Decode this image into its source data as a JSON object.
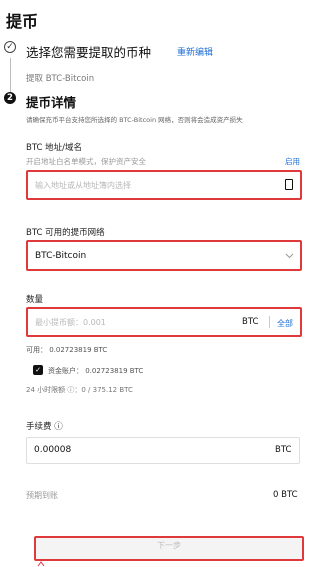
{
  "page": {
    "title": "提币"
  },
  "step1": {
    "number": "✓",
    "title": "选择您需要提取的币种",
    "edit_label": "重新编辑",
    "selected": "提取 BTC-Bitcoin"
  },
  "step2": {
    "number": "2",
    "title": "提币详情",
    "notice": "请确保充币平台支持您所选择的 BTC-Bitcoin 网络，否则将会造成资产损失"
  },
  "address": {
    "label": "BTC 地址/域名",
    "hint": "开启地址白名单模式，保护资产安全",
    "action": "启用",
    "placeholder": "输入地址或从地址簿内选择"
  },
  "network": {
    "label": "BTC 可用的提币网络",
    "value": "BTC-Bitcoin"
  },
  "amount": {
    "label": "数量",
    "placeholder": "最小提币额：0.001",
    "unit": "BTC",
    "all_label": "全部",
    "available": "可用：  0.02723819 BTC",
    "fund_account": "资金账户：  0.02723819 BTC",
    "limit": "24 小时限额 ⓘ：0 / 375.12 BTC"
  },
  "fee": {
    "label": "手续费 ⓘ",
    "value": "0.00008",
    "unit": "BTC"
  },
  "receive": {
    "label": "预期到账",
    "value": "0 BTC"
  },
  "footer": {
    "next_label": "下一步"
  }
}
